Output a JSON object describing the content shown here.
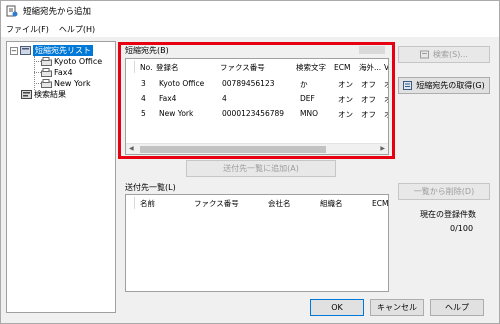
{
  "window": {
    "title": "短縮宛先から追加"
  },
  "menu": [
    {
      "label": "ファイル(F)"
    },
    {
      "label": "ヘルプ(H)"
    }
  ],
  "tree": {
    "root": "短縮宛先リスト",
    "children": [
      "Kyoto Office",
      "Fax4",
      "New York"
    ],
    "search_results": "検索結果",
    "expand_symbol": "−"
  },
  "abbrev": {
    "group_label": "短縮宛先(B)",
    "columns": [
      "No.",
      "登録名",
      "ファクス番号",
      "検索文字",
      "ECM",
      "海外...",
      "V"
    ],
    "rows": [
      [
        "3",
        "Kyoto Office",
        "00789456123",
        "か",
        "オン",
        "オフ",
        "オ"
      ],
      [
        "4",
        "Fax4",
        "4",
        "DEF",
        "オン",
        "オフ",
        "オ"
      ],
      [
        "5",
        "New York",
        "0000123456789",
        "MNO",
        "オン",
        "オフ",
        "オ"
      ]
    ]
  },
  "add_button": "送付先一覧に追加(A)",
  "dest": {
    "group_label": "送付先一覧(L)",
    "columns": [
      "名前",
      "ファクス番号",
      "会社名",
      "組織名",
      "ECM"
    ]
  },
  "buttons": {
    "search": "検索(S)...",
    "get_list": "短縮宛先の取得(G)",
    "remove": "一覧から削除(D)",
    "ok": "OK",
    "cancel": "キャンセル",
    "help": "ヘルプ"
  },
  "count": {
    "label": "現在の登録件数",
    "value": "0/100"
  },
  "colors": {
    "highlight": "#e60012",
    "selection": "#0078d7"
  }
}
